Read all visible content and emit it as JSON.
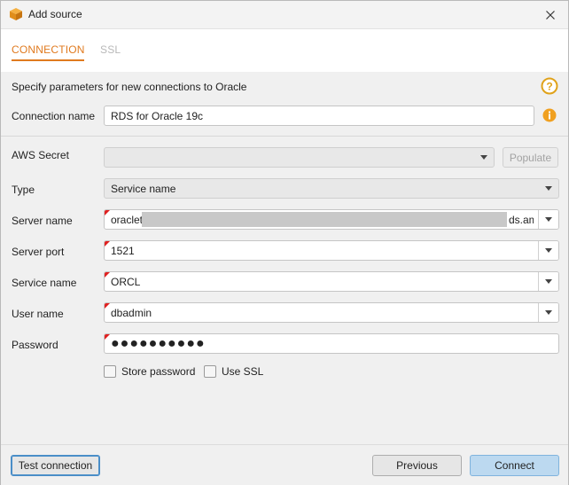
{
  "window": {
    "title": "Add source",
    "icon": "aws-box-icon"
  },
  "tabs": [
    {
      "label": "CONNECTION",
      "active": true
    },
    {
      "label": "SSL",
      "active": false
    }
  ],
  "header": {
    "text": "Specify parameters for new connections to Oracle"
  },
  "form": {
    "connection_name": {
      "label": "Connection name",
      "value": "RDS for Oracle 19c"
    },
    "aws_secret": {
      "label": "AWS Secret",
      "value": ""
    },
    "populate_label": "Populate",
    "type": {
      "label": "Type",
      "value": "Service name"
    },
    "server_name": {
      "label": "Server name",
      "prefix": "oraclet",
      "suffix": "ds.am"
    },
    "server_port": {
      "label": "Server port",
      "value": "1521"
    },
    "service_name": {
      "label": "Service name",
      "value": "ORCL"
    },
    "user_name": {
      "label": "User name",
      "value": "dbadmin"
    },
    "password": {
      "label": "Password",
      "value": "●●●●●●●●●●"
    },
    "store_password": {
      "label": "Store password",
      "checked": false
    },
    "use_ssl": {
      "label": "Use SSL",
      "checked": false
    }
  },
  "footer": {
    "test_label": "Test connection",
    "previous_label": "Previous",
    "connect_label": "Connect"
  },
  "colors": {
    "accent": "#e07a1f",
    "required_marker": "#e02020",
    "primary_button": "#bcd9f0"
  }
}
